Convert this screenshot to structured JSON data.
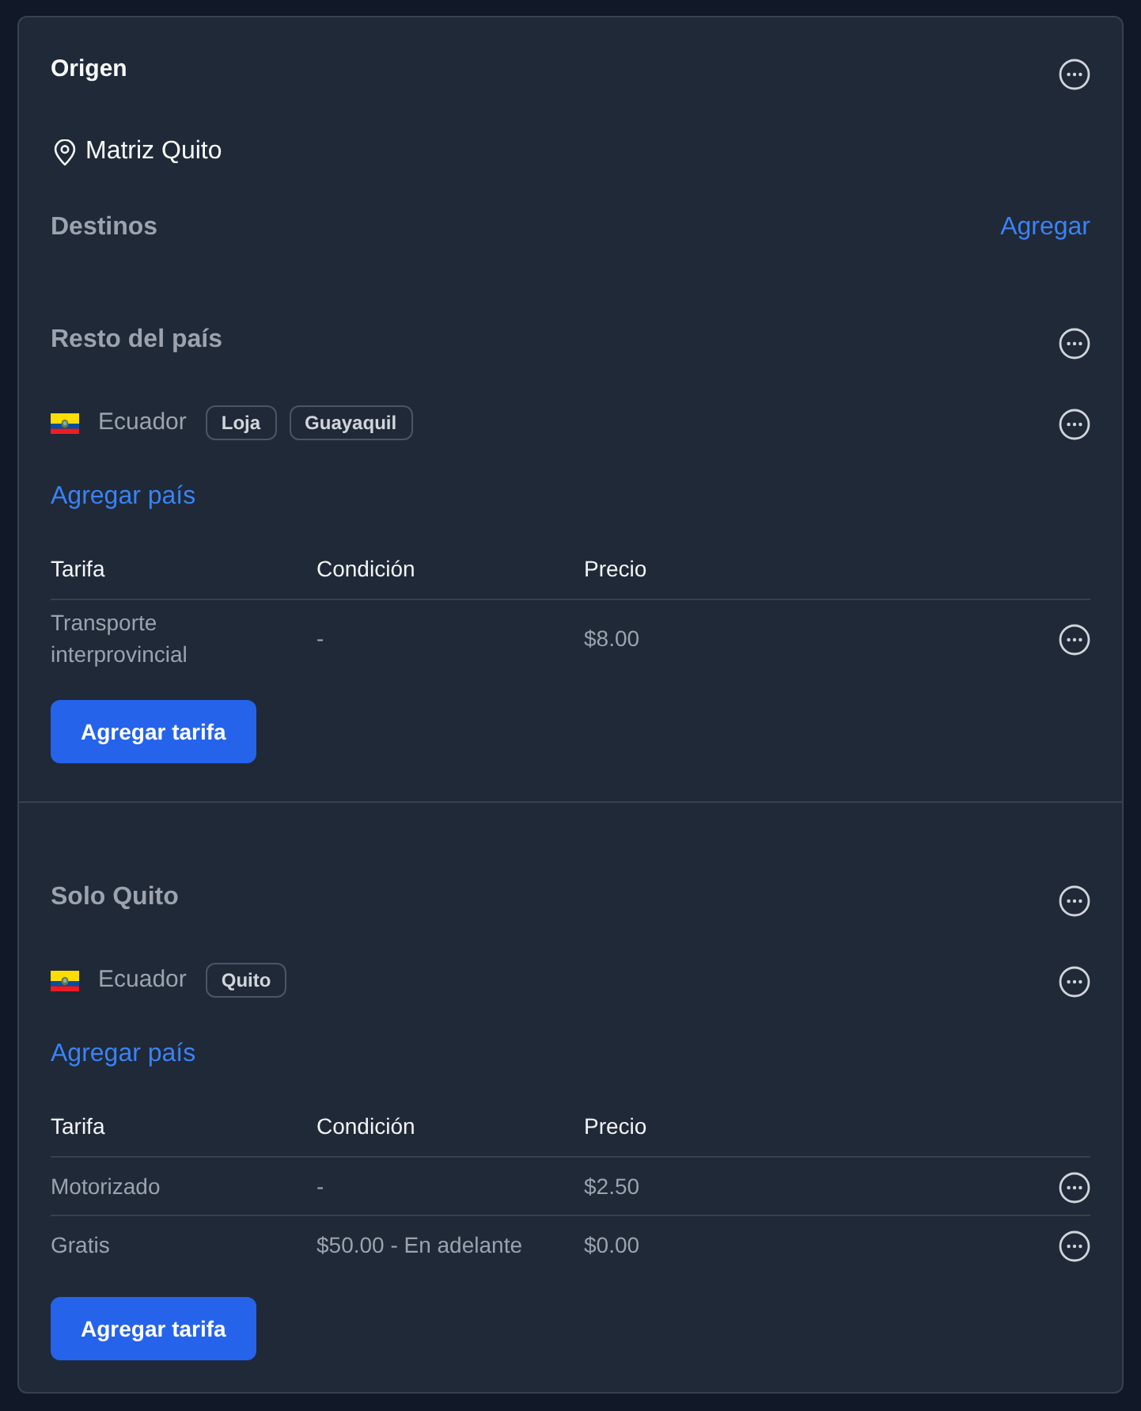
{
  "origin": {
    "title": "Origen",
    "location": "Matriz Quito"
  },
  "destinations": {
    "title": "Destinos",
    "add_link": "Agregar"
  },
  "groups": [
    {
      "title": "Resto del país",
      "countries": [
        {
          "name": "Ecuador",
          "cities": [
            "Loja",
            "Guayaquil"
          ]
        }
      ],
      "add_country": "Agregar país",
      "table": {
        "columns": [
          "Tarifa",
          "Condición",
          "Precio"
        ],
        "rows": [
          {
            "rate": "Transporte interprovincial",
            "condition": "-",
            "price": "$8.00"
          }
        ]
      },
      "add_rate": "Agregar tarifa"
    },
    {
      "title": "Solo Quito",
      "countries": [
        {
          "name": "Ecuador",
          "cities": [
            "Quito"
          ]
        }
      ],
      "add_country": "Agregar país",
      "table": {
        "columns": [
          "Tarifa",
          "Condición",
          "Precio"
        ],
        "rows": [
          {
            "rate": "Motorizado",
            "condition": "-",
            "price": "$2.50"
          },
          {
            "rate": "Gratis",
            "condition": "$50.00 - En adelante",
            "price": "$0.00"
          }
        ]
      },
      "add_rate": "Agregar tarifa"
    }
  ]
}
